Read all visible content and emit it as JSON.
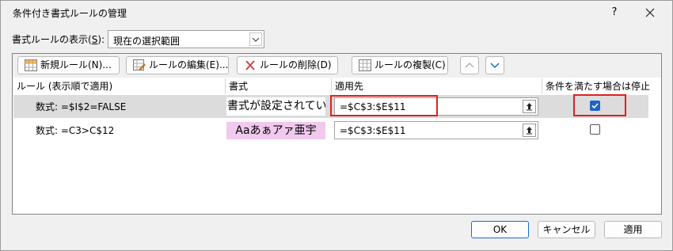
{
  "dialog": {
    "title": "条件付き書式ルールの管理",
    "help_label": "?",
    "close_icon": "close-icon"
  },
  "scope": {
    "label_prefix": "書式ルールの表示(",
    "label_key": "S",
    "label_suffix": "):",
    "selected_value": "現在の選択範囲"
  },
  "toolbar": {
    "new_rule": "新規ルール(N)...",
    "edit_rule": "ルールの編集(E)...",
    "delete_rule": "ルールの削除(D)",
    "duplicate_rule": "ルールの複製(C)",
    "icons": [
      "new-rule-icon",
      "edit-rule-icon",
      "delete-x-icon",
      "duplicate-rule-icon",
      "move-up-icon",
      "move-down-icon"
    ]
  },
  "columns": {
    "rule": "ルール (表示順で適用)",
    "format": "書式",
    "applies_to": "適用先",
    "stop_if_true": "条件を満たす場合は停止"
  },
  "rules": [
    {
      "condition": "数式: =$I$2=FALSE",
      "format_preview": "書式が設定されていません",
      "applies_to": "=$C$3:$E$11",
      "stop_if_true": true,
      "selected": true
    },
    {
      "condition": "数式: =C3>C$12",
      "format_preview": "Aaあぁアァ亜宇",
      "applies_to": "=$C$3:$E$11",
      "stop_if_true": false,
      "selected": false
    }
  ],
  "footer": {
    "ok": "OK",
    "cancel": "キャンセル",
    "apply": "適用"
  },
  "colors": {
    "accent": "#1c6ad6",
    "checkbox_checked": "#1d64c7",
    "highlight": "#e02020",
    "preview_fill": "#f1c9ee",
    "selected_row": "#dcdcdc"
  }
}
